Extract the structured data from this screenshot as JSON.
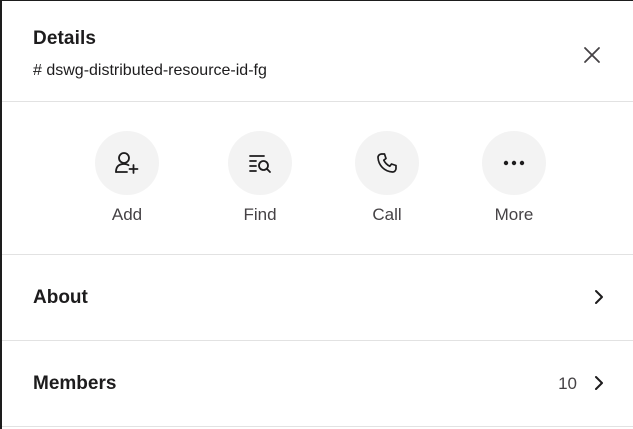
{
  "header": {
    "title": "Details",
    "subtitle": "# dswg-distributed-resource-id-fg",
    "close_icon": "close-icon"
  },
  "actions": [
    {
      "label": "Add",
      "icon": "add-person-icon"
    },
    {
      "label": "Find",
      "icon": "find-in-list-icon"
    },
    {
      "label": "Call",
      "icon": "phone-icon"
    },
    {
      "label": "More",
      "icon": "more-horizontal-icon"
    }
  ],
  "rows": [
    {
      "label": "About",
      "count": "",
      "icon": "chevron-right-icon"
    },
    {
      "label": "Members",
      "count": "10",
      "icon": "chevron-right-icon"
    }
  ],
  "colors": {
    "text": "#1d1c1d",
    "muted": "#454245",
    "circle_bg": "#f3f3f3",
    "divider": "#e2e2e2"
  }
}
